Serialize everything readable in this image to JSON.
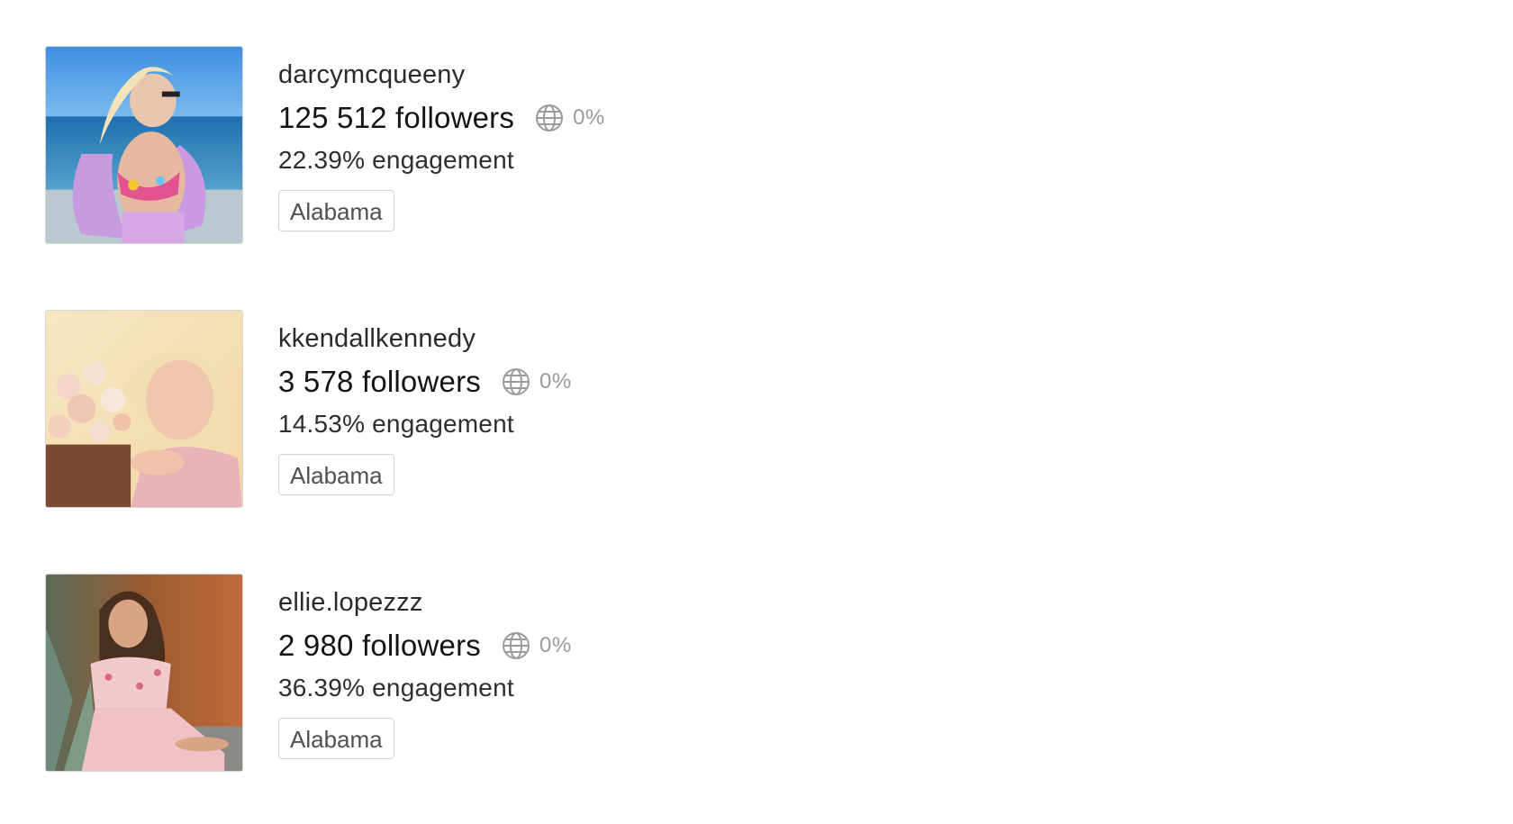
{
  "accounts": [
    {
      "username": "darcymcqueeny",
      "followers": "125 512 followers",
      "percent": "0%",
      "engagement": "22.39% engagement",
      "location": "Alabama",
      "icon": "globe-icon"
    },
    {
      "username": "kkendallkennedy",
      "followers": "3 578 followers",
      "percent": "0%",
      "engagement": "14.53% engagement",
      "location": "Alabama",
      "icon": "globe-icon"
    },
    {
      "username": "ellie.lopezzz",
      "followers": "2 980 followers",
      "percent": "0%",
      "engagement": "36.39% engagement",
      "location": "Alabama",
      "icon": "globe-icon"
    }
  ],
  "colors": {
    "text": "#1f1f1f",
    "muted": "#9a9a9a",
    "border": "#d4d4d4"
  }
}
